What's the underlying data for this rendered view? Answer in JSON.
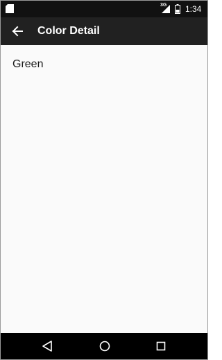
{
  "status_bar": {
    "network_label": "3G",
    "time": "1:34",
    "icons": [
      "sd-card-icon",
      "signal-icon",
      "battery-icon"
    ]
  },
  "toolbar": {
    "back_icon": "arrow-back-icon",
    "title": "Color Detail"
  },
  "content": {
    "color_name": "Green"
  },
  "nav_bar": {
    "icons": [
      "nav-back-icon",
      "nav-home-icon",
      "nav-recents-icon"
    ]
  },
  "colors": {
    "status_bar_bg": "#111111",
    "toolbar_bg": "#212121",
    "content_bg": "#fafafa",
    "nav_bar_bg": "#000000"
  }
}
